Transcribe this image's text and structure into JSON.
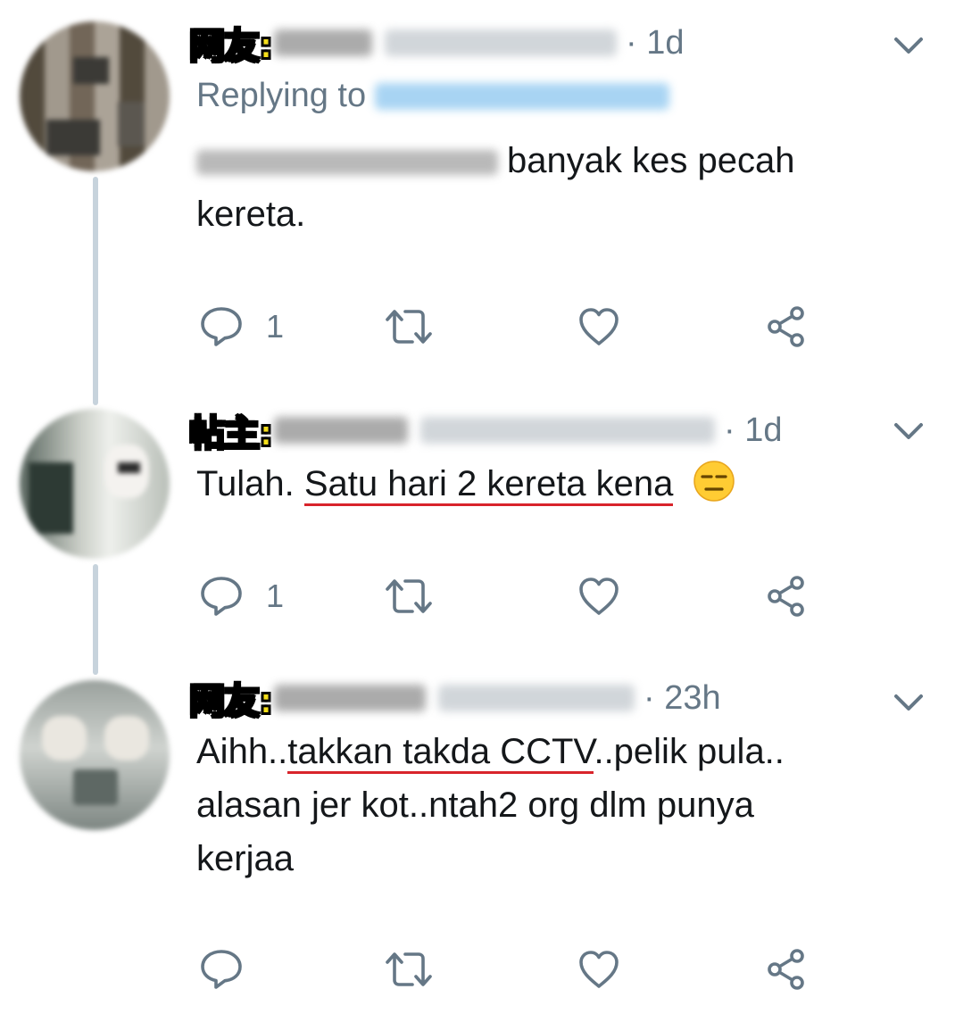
{
  "tweets": [
    {
      "tag": "网友:",
      "time_sep": "·",
      "time": "1d",
      "replying_prefix": "Replying to",
      "body_text": "banyak kes pecah kereta.",
      "reply_count": "1"
    },
    {
      "tag": "帖主:",
      "time_sep": "·",
      "time": "1d",
      "body_plain": "Tulah. ",
      "body_underlined": "Satu hari 2 kereta kena",
      "reply_count": "1"
    },
    {
      "tag": "网友:",
      "time_sep": "·",
      "time": "23h",
      "body_plain_start": "Aihh..",
      "body_underlined": "takkan takda CCTV",
      "body_plain_end": "..pelik pula.. alasan jer kot..ntah2 org dlm punya kerjaa",
      "reply_count": ""
    }
  ],
  "colors": {
    "tag_fill": "#f7e01a",
    "tag_stroke": "#000000",
    "secondary_text": "#657786",
    "underline": "#d8242b",
    "thread_line": "#c7d3dc",
    "icon_stroke": "#657786"
  },
  "icons": [
    "chevron-down-icon",
    "reply-icon",
    "retweet-icon",
    "like-icon",
    "share-icon",
    "expressionless-face-emoji"
  ]
}
